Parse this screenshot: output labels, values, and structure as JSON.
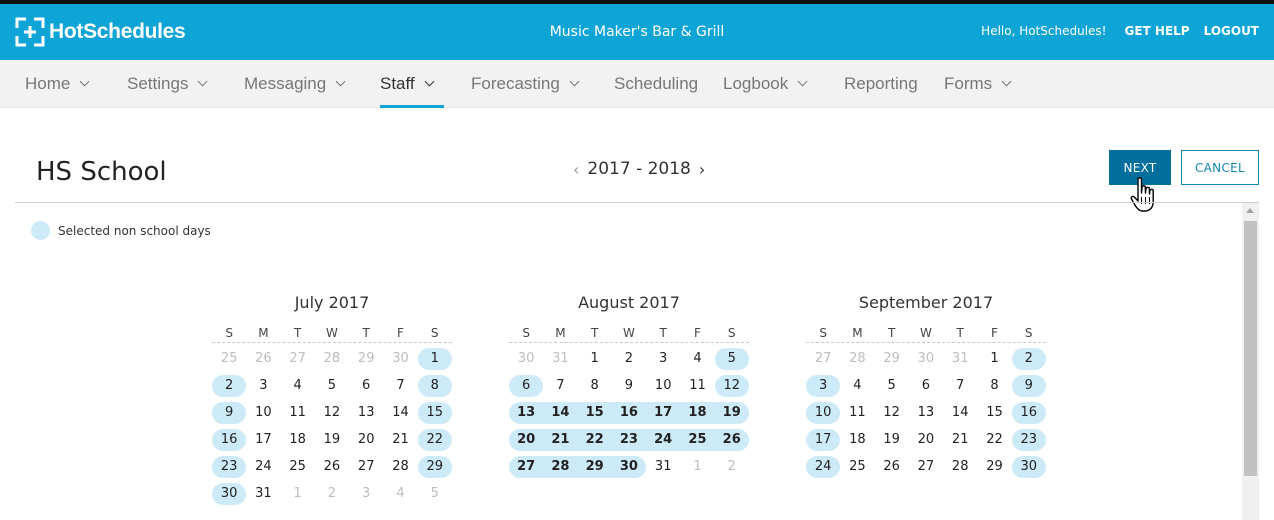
{
  "header": {
    "logo_text": "HotSchedules",
    "site_name": "Music Maker's Bar & Grill",
    "greeting": "Hello, HotSchedules!",
    "get_help": "GET HELP",
    "logout": "LOGOUT",
    "color": "#0ea4d5"
  },
  "nav": [
    {
      "label": "Home",
      "dropdown": true
    },
    {
      "label": "Settings",
      "dropdown": true
    },
    {
      "label": "Messaging",
      "dropdown": true
    },
    {
      "label": "Staff",
      "dropdown": true,
      "active": true
    },
    {
      "label": "Forecasting",
      "dropdown": true
    },
    {
      "label": "Scheduling",
      "dropdown": false
    },
    {
      "label": "Logbook",
      "dropdown": true
    },
    {
      "label": "Reporting",
      "dropdown": false
    },
    {
      "label": "Forms",
      "dropdown": true
    }
  ],
  "page": {
    "title": "HS School",
    "year_range": "2017 - 2018",
    "next_label": "NEXT",
    "cancel_label": "CANCEL",
    "legend_label": "Selected non school days",
    "selected_color": "#cceaf7"
  },
  "weekdays": [
    "S",
    "M",
    "T",
    "W",
    "T",
    "F",
    "S"
  ],
  "months": [
    {
      "title": "July 2017",
      "days": [
        [
          {
            "d": "25",
            "m": 1
          },
          {
            "d": "26",
            "m": 1
          },
          {
            "d": "27",
            "m": 1
          },
          {
            "d": "28",
            "m": 1
          },
          {
            "d": "29",
            "m": 1
          },
          {
            "d": "30",
            "m": 1
          },
          {
            "d": "1",
            "s": 1
          }
        ],
        [
          {
            "d": "2",
            "s": 1
          },
          {
            "d": "3"
          },
          {
            "d": "4"
          },
          {
            "d": "5"
          },
          {
            "d": "6"
          },
          {
            "d": "7"
          },
          {
            "d": "8",
            "s": 1
          }
        ],
        [
          {
            "d": "9",
            "s": 1
          },
          {
            "d": "10"
          },
          {
            "d": "11"
          },
          {
            "d": "12"
          },
          {
            "d": "13"
          },
          {
            "d": "14"
          },
          {
            "d": "15",
            "s": 1
          }
        ],
        [
          {
            "d": "16",
            "s": 1
          },
          {
            "d": "17"
          },
          {
            "d": "18"
          },
          {
            "d": "19"
          },
          {
            "d": "20"
          },
          {
            "d": "21"
          },
          {
            "d": "22",
            "s": 1
          }
        ],
        [
          {
            "d": "23",
            "s": 1
          },
          {
            "d": "24"
          },
          {
            "d": "25"
          },
          {
            "d": "26"
          },
          {
            "d": "27"
          },
          {
            "d": "28"
          },
          {
            "d": "29",
            "s": 1
          }
        ],
        [
          {
            "d": "30",
            "s": 1
          },
          {
            "d": "31"
          },
          {
            "d": "1",
            "m": 1
          },
          {
            "d": "2",
            "m": 1
          },
          {
            "d": "3",
            "m": 1
          },
          {
            "d": "4",
            "m": 1
          },
          {
            "d": "5",
            "m": 1
          }
        ]
      ]
    },
    {
      "title": "August 2017",
      "days": [
        [
          {
            "d": "30",
            "m": 1
          },
          {
            "d": "31",
            "m": 1
          },
          {
            "d": "1"
          },
          {
            "d": "2"
          },
          {
            "d": "3"
          },
          {
            "d": "4"
          },
          {
            "d": "5",
            "s": 1
          }
        ],
        [
          {
            "d": "6",
            "s": 1
          },
          {
            "d": "7"
          },
          {
            "d": "8"
          },
          {
            "d": "9"
          },
          {
            "d": "10"
          },
          {
            "d": "11"
          },
          {
            "d": "12",
            "s": 1
          }
        ],
        [
          {
            "d": "13",
            "s": 1
          },
          {
            "d": "14",
            "s": 1
          },
          {
            "d": "15",
            "s": 1
          },
          {
            "d": "16",
            "s": 1
          },
          {
            "d": "17",
            "s": 1
          },
          {
            "d": "18",
            "s": 1
          },
          {
            "d": "19",
            "s": 1
          }
        ],
        [
          {
            "d": "20",
            "s": 1
          },
          {
            "d": "21",
            "s": 1
          },
          {
            "d": "22",
            "s": 1
          },
          {
            "d": "23",
            "s": 1
          },
          {
            "d": "24",
            "s": 1
          },
          {
            "d": "25",
            "s": 1
          },
          {
            "d": "26",
            "s": 1
          }
        ],
        [
          {
            "d": "27",
            "s": 1
          },
          {
            "d": "28",
            "s": 1
          },
          {
            "d": "29",
            "s": 1
          },
          {
            "d": "30",
            "s": 1
          },
          {
            "d": "31"
          },
          {
            "d": "1",
            "m": 1
          },
          {
            "d": "2",
            "m": 1
          }
        ]
      ]
    },
    {
      "title": "September 2017",
      "days": [
        [
          {
            "d": "27",
            "m": 1
          },
          {
            "d": "28",
            "m": 1
          },
          {
            "d": "29",
            "m": 1
          },
          {
            "d": "30",
            "m": 1
          },
          {
            "d": "31",
            "m": 1
          },
          {
            "d": "1"
          },
          {
            "d": "2",
            "s": 1
          }
        ],
        [
          {
            "d": "3",
            "s": 1
          },
          {
            "d": "4"
          },
          {
            "d": "5"
          },
          {
            "d": "6"
          },
          {
            "d": "7"
          },
          {
            "d": "8"
          },
          {
            "d": "9",
            "s": 1
          }
        ],
        [
          {
            "d": "10",
            "s": 1
          },
          {
            "d": "11"
          },
          {
            "d": "12"
          },
          {
            "d": "13"
          },
          {
            "d": "14"
          },
          {
            "d": "15"
          },
          {
            "d": "16",
            "s": 1
          }
        ],
        [
          {
            "d": "17",
            "s": 1
          },
          {
            "d": "18"
          },
          {
            "d": "19"
          },
          {
            "d": "20"
          },
          {
            "d": "21"
          },
          {
            "d": "22"
          },
          {
            "d": "23",
            "s": 1
          }
        ],
        [
          {
            "d": "24",
            "s": 1
          },
          {
            "d": "25"
          },
          {
            "d": "26"
          },
          {
            "d": "27"
          },
          {
            "d": "28"
          },
          {
            "d": "29"
          },
          {
            "d": "30",
            "s": 1
          }
        ]
      ]
    }
  ]
}
